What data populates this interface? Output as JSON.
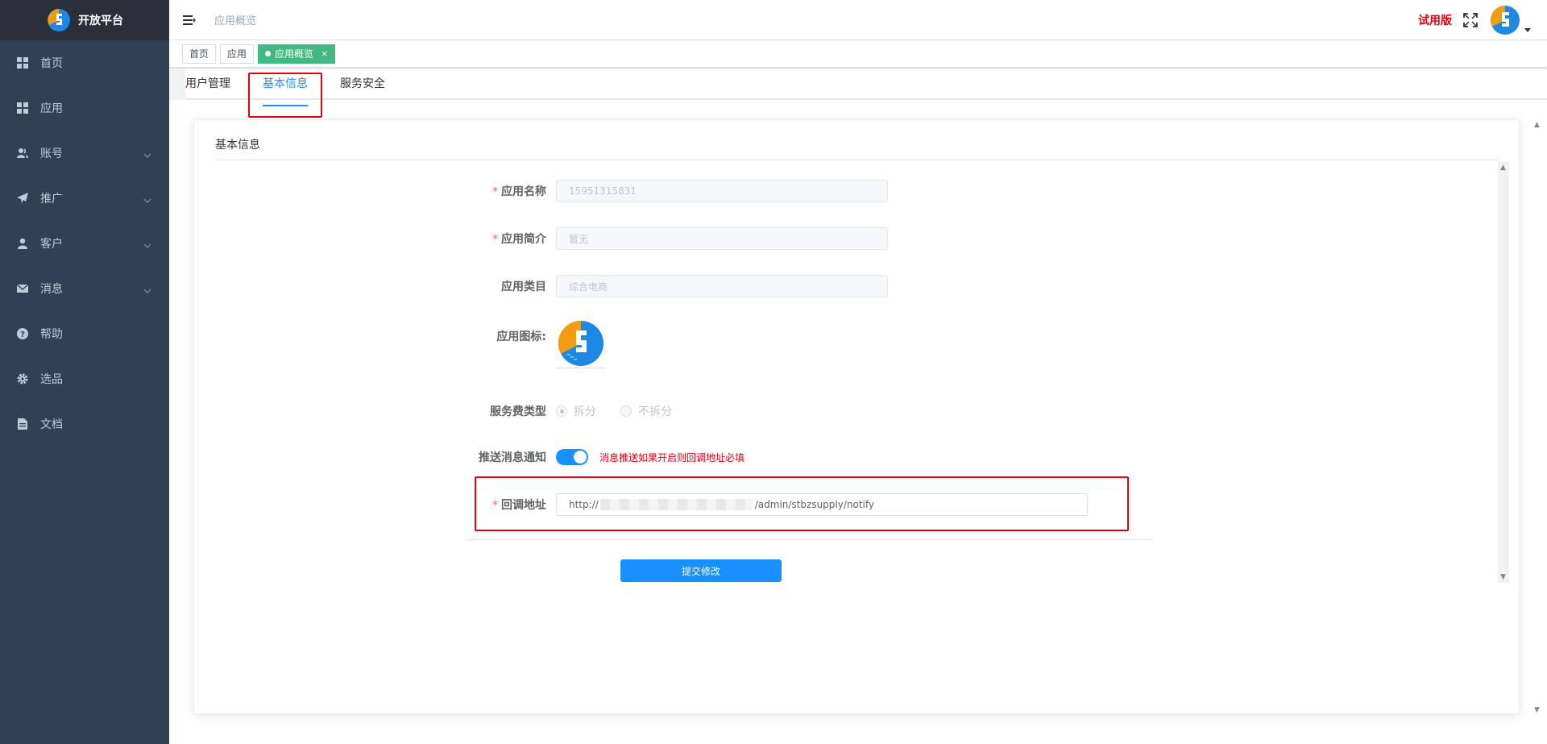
{
  "sidebar": {
    "logo_text": "开放平台",
    "items": [
      {
        "label": "首页",
        "icon": "dashboard-icon",
        "has_arrow": false
      },
      {
        "label": "应用",
        "icon": "apps-icon",
        "has_arrow": false
      },
      {
        "label": "账号",
        "icon": "account-icon",
        "has_arrow": true
      },
      {
        "label": "推广",
        "icon": "send-icon",
        "has_arrow": true
      },
      {
        "label": "客户",
        "icon": "user-icon",
        "has_arrow": true
      },
      {
        "label": "消息",
        "icon": "mail-icon",
        "has_arrow": true
      },
      {
        "label": "帮助",
        "icon": "help-icon",
        "has_arrow": false
      },
      {
        "label": "选品",
        "icon": "gear-icon",
        "has_arrow": false
      },
      {
        "label": "文档",
        "icon": "document-icon",
        "has_arrow": false
      }
    ]
  },
  "header": {
    "breadcrumb": "应用概览",
    "trial_label": "试用版"
  },
  "tags": [
    {
      "label": "首页",
      "active": false
    },
    {
      "label": "应用",
      "active": false
    },
    {
      "label": "应用概览",
      "active": true,
      "close": "×"
    }
  ],
  "tabs": [
    {
      "label": "用户管理",
      "active": false
    },
    {
      "label": "基本信息",
      "active": true
    },
    {
      "label": "服务安全",
      "active": false
    }
  ],
  "card": {
    "title": "基本信息"
  },
  "form": {
    "app_name": {
      "label": "应用名称",
      "required": "*",
      "value": "15951315831"
    },
    "app_intro": {
      "label": "应用简介",
      "required": "*",
      "value": "暂无"
    },
    "app_category": {
      "label": "应用类目",
      "value": "综合电商"
    },
    "app_icon": {
      "label": "应用图标:"
    },
    "fee_type": {
      "label": "服务费类型",
      "options": [
        {
          "label": "拆分",
          "checked": true
        },
        {
          "label": "不拆分",
          "checked": false
        }
      ]
    },
    "push_notify": {
      "label": "推送消息通知",
      "enabled": true,
      "hint": "消息推送如果开启则回调地址必填"
    },
    "callback_url": {
      "label": "回调地址",
      "required": "*",
      "prefix": "http://",
      "suffix": "/admin/stbzsupply/notify"
    },
    "submit_label": "提交修改"
  },
  "colors": {
    "sidebar_bg": "#304156",
    "primary": "#1890ff",
    "tag_active": "#42b983",
    "highlight": "#e60012"
  }
}
